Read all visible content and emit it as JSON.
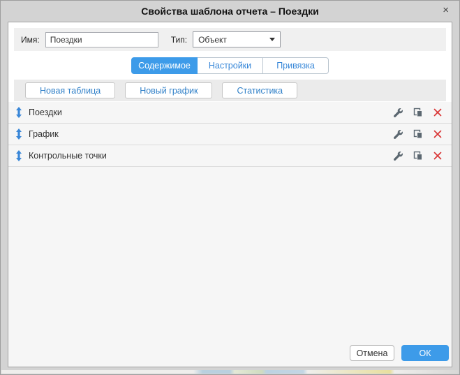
{
  "dialog": {
    "title": "Свойства шаблона отчета – Поездки",
    "close_label": "×"
  },
  "form": {
    "name_label": "Имя:",
    "name_value": "Поездки",
    "type_label": "Тип:",
    "type_value": "Объект"
  },
  "tabs": [
    {
      "label": "Содержимое",
      "active": true
    },
    {
      "label": "Настройки",
      "active": false
    },
    {
      "label": "Привязка",
      "active": false
    }
  ],
  "toolbar": {
    "new_table_label": "Новая таблица",
    "new_chart_label": "Новый график",
    "statistics_label": "Статистика"
  },
  "list": {
    "rows": [
      {
        "label": "Поездки"
      },
      {
        "label": "График"
      },
      {
        "label": "Контрольные точки"
      }
    ],
    "row_icon_names": [
      "drag-handle-icon",
      "wrench-icon",
      "copy-icon",
      "delete-icon"
    ]
  },
  "footer": {
    "cancel_label": "Отмена",
    "ok_label": "ОК"
  },
  "colors": {
    "accent_blue": "#3d9be9",
    "link_blue": "#3787d8",
    "drag_blue": "#3a87d8",
    "icon_gray": "#5b6770",
    "delete_red": "#d93636"
  }
}
